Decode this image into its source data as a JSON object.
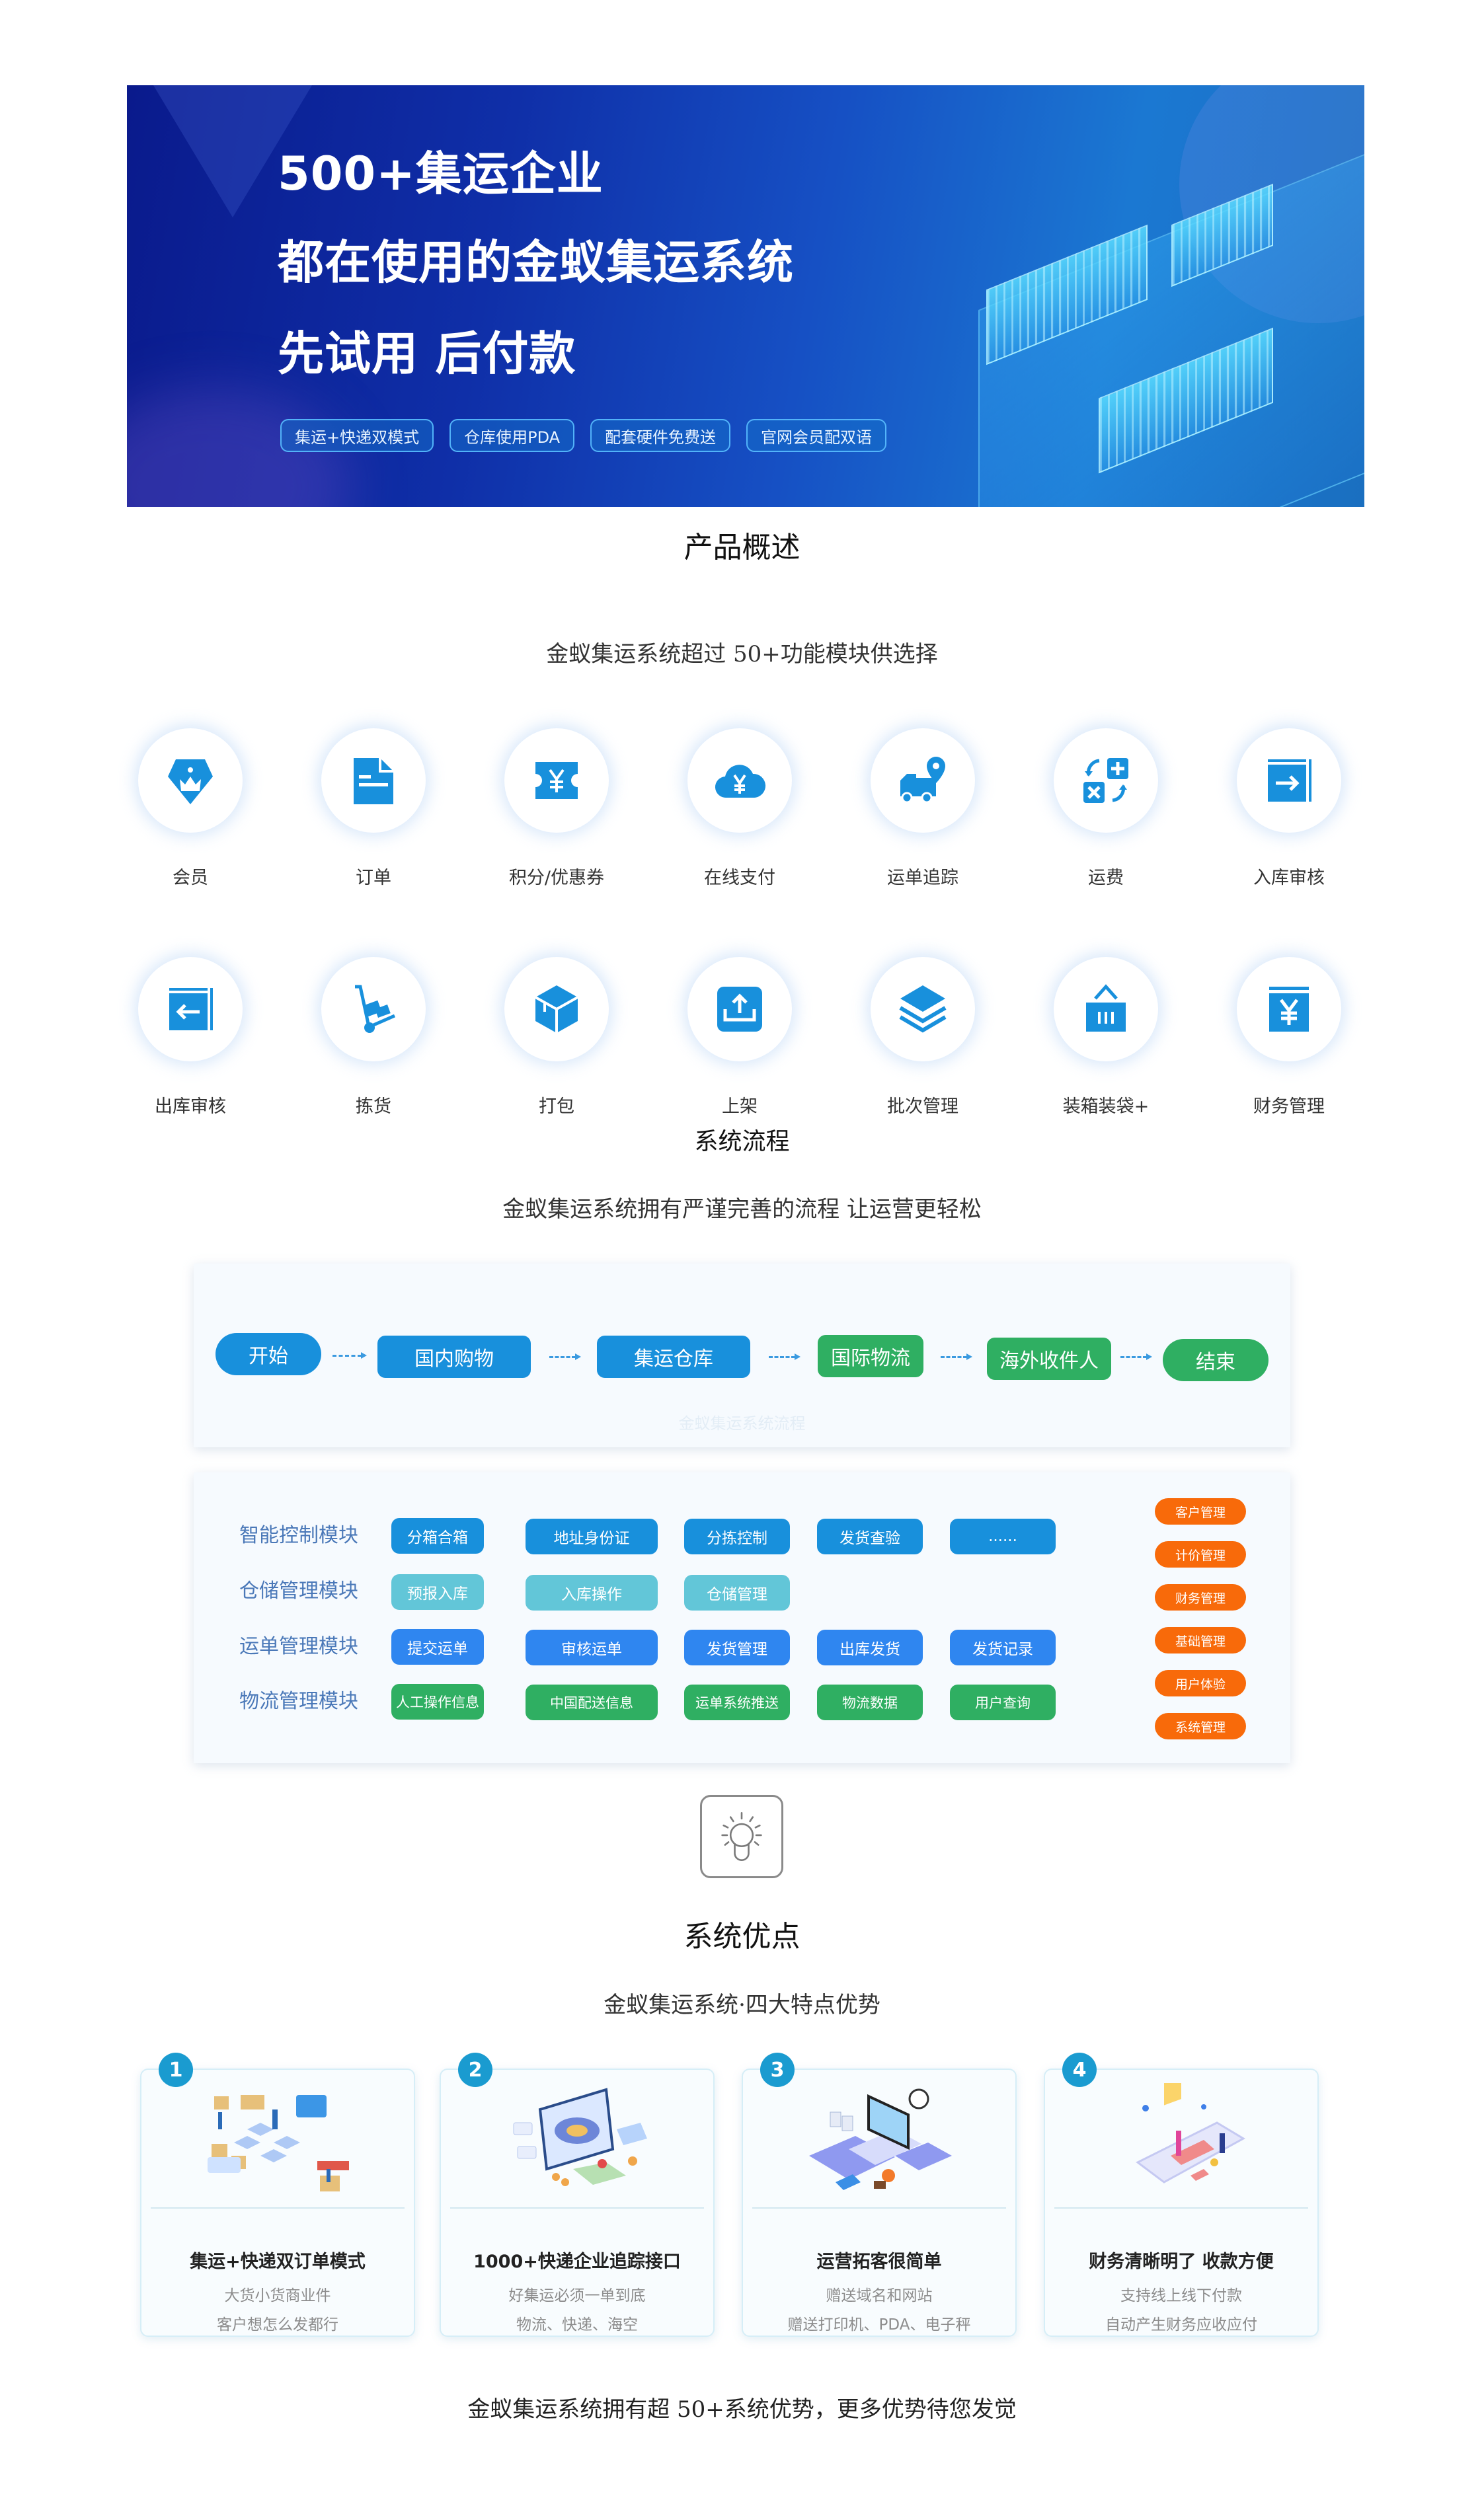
{
  "banner": {
    "line1": "500+集运企业",
    "line2": "都在使用的金蚁集运系统",
    "line3": "先试用 后付款",
    "tags": [
      "集运+快递双模式",
      "仓库使用PDA",
      "配套硬件免费送",
      "官网会员配双语"
    ]
  },
  "overview": {
    "title": "产品概述",
    "subtitle": "金蚁集运系统超过 50+功能模块供选择",
    "row1": [
      {
        "label": "会员",
        "icon": "member-crown-icon"
      },
      {
        "label": "订单",
        "icon": "order-document-icon"
      },
      {
        "label": "积分/优惠券",
        "icon": "coupon-ticket-icon"
      },
      {
        "label": "在线支付",
        "icon": "cloud-payment-icon"
      },
      {
        "label": "运单追踪",
        "icon": "truck-location-icon"
      },
      {
        "label": "运费",
        "icon": "calculator-icon"
      },
      {
        "label": "入库审核",
        "icon": "inbound-arrow-icon"
      }
    ],
    "row2": [
      {
        "label": "出库审核",
        "icon": "outbound-arrow-icon"
      },
      {
        "label": "拣货",
        "icon": "hand-cart-icon"
      },
      {
        "label": "打包",
        "icon": "package-box-icon"
      },
      {
        "label": "上架",
        "icon": "upload-shelf-icon"
      },
      {
        "label": "批次管理",
        "icon": "layers-icon"
      },
      {
        "label": "装箱装袋+",
        "icon": "bag-icon"
      },
      {
        "label": "财务管理",
        "icon": "finance-yuan-icon"
      }
    ]
  },
  "flow": {
    "title": "系统流程",
    "subtitle": "金蚁集运系统拥有严谨完善的流程  让运营更轻松",
    "steps": [
      {
        "label": "开始",
        "color": "blue"
      },
      {
        "label": "国内购物",
        "color": "blue"
      },
      {
        "label": "集运仓库",
        "color": "blue"
      },
      {
        "label": "国际物流",
        "color": "green"
      },
      {
        "label": "海外收件人",
        "color": "green"
      },
      {
        "label": "结束",
        "color": "green"
      }
    ],
    "watermark": "金蚁集运系统流程"
  },
  "modules": {
    "rows": [
      {
        "name": "智能控制模块",
        "items": [
          "分箱合箱",
          "地址身份证",
          "分拣控制",
          "发货查验",
          "......"
        ]
      },
      {
        "name": "仓储管理模块",
        "items": [
          "预报入库",
          "入库操作",
          "仓储管理"
        ]
      },
      {
        "name": "运单管理模块",
        "items": [
          "提交运单",
          "审核运单",
          "发货管理",
          "出库发货",
          "发货记录"
        ]
      },
      {
        "name": "物流管理模块",
        "items": [
          "人工操作信息",
          "中国配送信息",
          "运单系统推送",
          "物流数据",
          "用户查询"
        ]
      }
    ],
    "side": [
      "客户管理",
      "计价管理",
      "财务管理",
      "基础管理",
      "用户体验",
      "系统管理"
    ],
    "colors": {
      "blue": "#1890dc",
      "cyan": "#62c6d8",
      "brand": "#2f86f0",
      "green": "#2faf62",
      "orange": "#f86a0a"
    }
  },
  "advantages": {
    "title": "系统优点",
    "subtitle": "金蚁集运系统·四大特点优势",
    "cards": [
      {
        "num": "1",
        "title": "集运+快递双订单模式",
        "line1": "大货小货商业件",
        "line2": "客户想怎么发都行"
      },
      {
        "num": "2",
        "title": "1000+快递企业追踪接口",
        "line1": "好集运必须一单到底",
        "line2": "物流、快递、海空"
      },
      {
        "num": "3",
        "title": "运营拓客很简单",
        "line1": "赠送域名和网站",
        "line2": "赠送打印机、PDA、电子秤"
      },
      {
        "num": "4",
        "title": "财务清晰明了 收款方便",
        "line1": "支持线上线下付款",
        "line2": "自动产生财务应收应付"
      }
    ],
    "footer": "金蚁集运系统拥有超 50+系统优势，更多优势待您发觉"
  }
}
